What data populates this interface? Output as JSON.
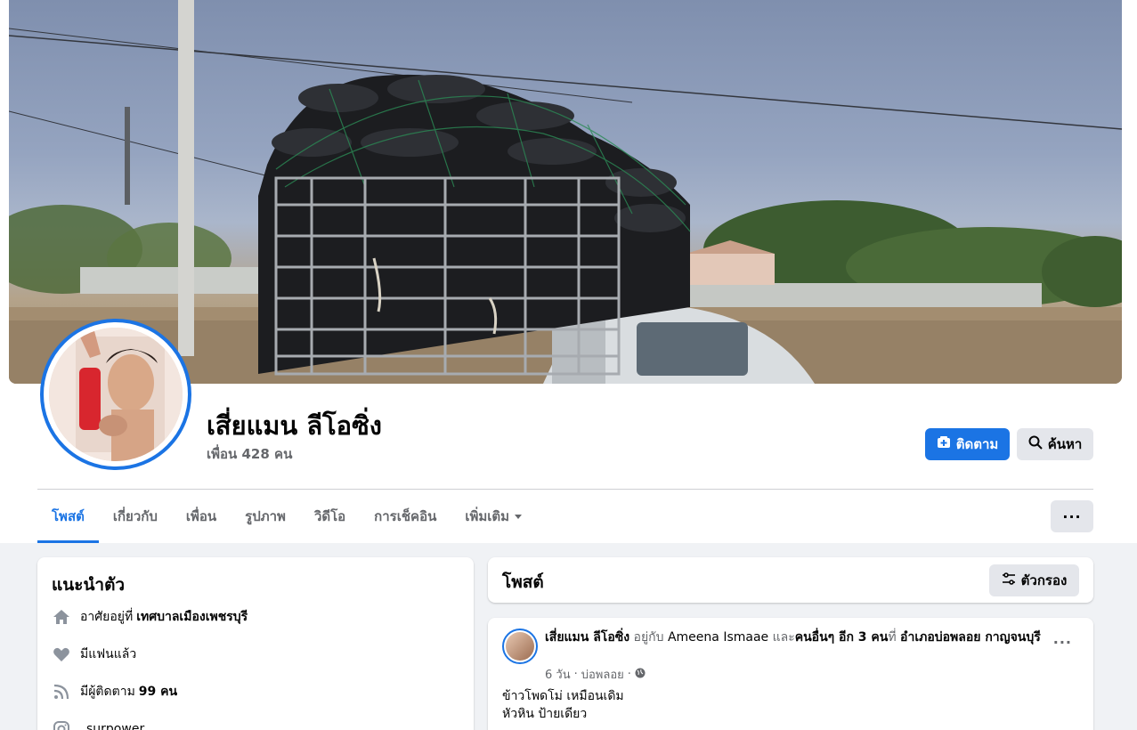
{
  "profile": {
    "name": "เสี่ยแมน ลีโอซิ่ง",
    "friends": "เพื่อน 428 คน"
  },
  "actions": {
    "follow_label": "ติดตาม",
    "search_label": "ค้นหา",
    "more_label": "···"
  },
  "tabs": [
    {
      "label": "โพสต์",
      "active": true
    },
    {
      "label": "เกี่ยวกับ"
    },
    {
      "label": "เพื่อน"
    },
    {
      "label": "รูปภาพ"
    },
    {
      "label": "วิดีโอ"
    },
    {
      "label": "การเช็คอิน"
    },
    {
      "label": "เพิ่มเติม"
    }
  ],
  "intro": {
    "title": "แนะนำตัว",
    "lives_prefix": "อาศัยอยู่ที่",
    "lives_place": "เทศบาลเมืองเพชรบุรี",
    "relationship": "มีแฟนแล้ว",
    "followers_prefix": "มีผู้ติดตาม",
    "followers_count": "99 คน",
    "instagram": "_surpower_"
  },
  "posts_header": {
    "title": "โพสต์",
    "filter_label": "ตัวกรอง"
  },
  "post": {
    "author": "เสี่ยแมน ลีโอซิ่ง",
    "with_text": "อยู่กับ",
    "tagged": "Ameena Ismaae",
    "and_text": "และ",
    "others": "คนอื่นๆ อีก 3 คน",
    "at_text": "ที่",
    "place": "อำเภอบ่อพลอย กาญจนบุรี",
    "time": "6 วัน",
    "location": "บ่อพลอย",
    "line1": "ข้าวโพดโม่ เหมือนเดิม",
    "line2": "หัวหิน ป้ายเดียว"
  },
  "colors": {
    "accent": "#1b74e4",
    "secondary_button": "#e4e6eb",
    "page_background": "#f0f2f5",
    "muted_text": "#65676b"
  }
}
